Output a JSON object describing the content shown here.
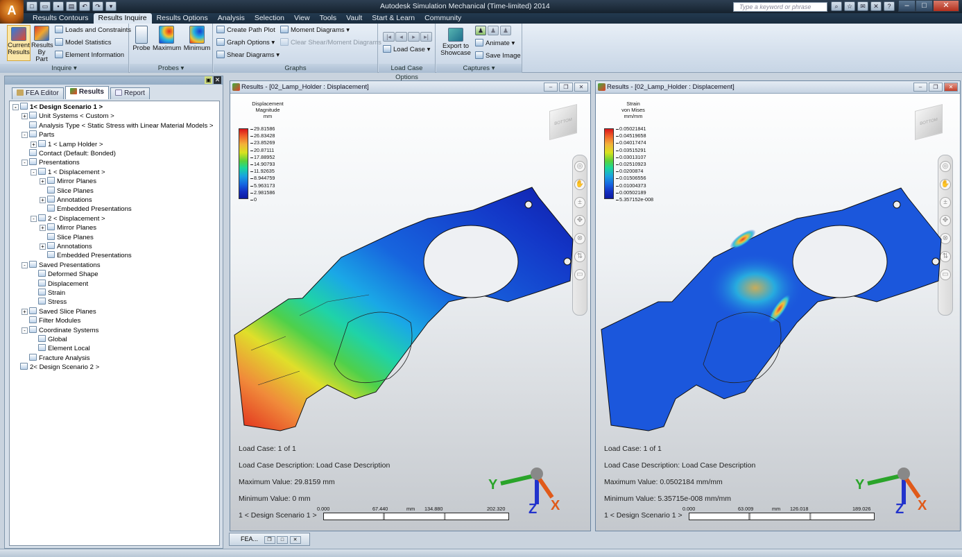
{
  "app": {
    "title": "Autodesk Simulation Mechanical (Time-limited) 2014",
    "search_placeholder": "Type a keyword or phrase"
  },
  "ribbon_tabs": [
    "Results Contours",
    "Results Inquire",
    "Results Options",
    "Analysis",
    "Selection",
    "View",
    "Tools",
    "Vault",
    "Start & Learn",
    "Community"
  ],
  "ribbon": {
    "inquire": {
      "title": "Inquire",
      "current_results": "Current Results",
      "results_by_part": "Results By Part",
      "loads_constraints": "Loads and Constraints",
      "model_statistics": "Model Statistics",
      "element_information": "Element Information"
    },
    "probes": {
      "title": "Probes",
      "probe": "Probe",
      "maximum": "Maximum",
      "minimum": "Minimum"
    },
    "graphs": {
      "title": "Graphs",
      "create_path_plot": "Create Path Plot",
      "graph_options": "Graph Options",
      "shear_diagrams": "Shear Diagrams",
      "moment_diagrams": "Moment Diagrams",
      "clear_shear_moment": "Clear Shear/Moment Diagrams"
    },
    "load_case_options": {
      "title": "Load Case Options",
      "load_case": "Load Case"
    },
    "captures": {
      "title": "Captures",
      "export_to_showcase": "Export to Showcase",
      "animate": "Animate",
      "save_image": "Save Image"
    }
  },
  "left_tabs": [
    "FEA Editor",
    "Results",
    "Report"
  ],
  "tree": [
    {
      "label": "1< Design Scenario 1 >",
      "depth": 0,
      "exp": "-",
      "bold": true
    },
    {
      "label": "Unit Systems < Custom >",
      "depth": 1,
      "exp": "+"
    },
    {
      "label": "Analysis Type < Static Stress with Linear Material Models >",
      "depth": 1,
      "exp": ""
    },
    {
      "label": "Parts",
      "depth": 1,
      "exp": "-"
    },
    {
      "label": "1 < Lamp Holder >",
      "depth": 2,
      "exp": "+"
    },
    {
      "label": "Contact (Default: Bonded)",
      "depth": 1,
      "exp": ""
    },
    {
      "label": "Presentations",
      "depth": 1,
      "exp": "-"
    },
    {
      "label": "1 < Displacement >",
      "depth": 2,
      "exp": "-"
    },
    {
      "label": "Mirror Planes",
      "depth": 3,
      "exp": "+"
    },
    {
      "label": "Slice Planes",
      "depth": 3,
      "exp": ""
    },
    {
      "label": "Annotations",
      "depth": 3,
      "exp": "+"
    },
    {
      "label": "Embedded Presentations",
      "depth": 3,
      "exp": ""
    },
    {
      "label": "2 < Displacement >",
      "depth": 2,
      "exp": "-"
    },
    {
      "label": "Mirror Planes",
      "depth": 3,
      "exp": "+"
    },
    {
      "label": "Slice Planes",
      "depth": 3,
      "exp": ""
    },
    {
      "label": "Annotations",
      "depth": 3,
      "exp": "+"
    },
    {
      "label": "Embedded Presentations",
      "depth": 3,
      "exp": ""
    },
    {
      "label": "Saved Presentations",
      "depth": 1,
      "exp": "-"
    },
    {
      "label": "Deformed Shape",
      "depth": 2,
      "exp": ""
    },
    {
      "label": "Displacement",
      "depth": 2,
      "exp": ""
    },
    {
      "label": "Strain",
      "depth": 2,
      "exp": ""
    },
    {
      "label": "Stress",
      "depth": 2,
      "exp": ""
    },
    {
      "label": "Saved Slice Planes",
      "depth": 1,
      "exp": "+"
    },
    {
      "label": "Filter Modules",
      "depth": 1,
      "exp": ""
    },
    {
      "label": "Coordinate Systems",
      "depth": 1,
      "exp": "-"
    },
    {
      "label": "Global",
      "depth": 2,
      "exp": ""
    },
    {
      "label": "Element Local",
      "depth": 2,
      "exp": ""
    },
    {
      "label": "Fracture Analysis",
      "depth": 1,
      "exp": ""
    },
    {
      "label": "2< Design Scenario 2 >",
      "depth": 0,
      "exp": ""
    }
  ],
  "windows": [
    {
      "title": "Results - [02_Lamp_Holder : Displacement]",
      "legend_title": [
        "Displacement",
        "Magnitude",
        "mm"
      ],
      "legend_values": [
        "29.81586",
        "26.83428",
        "23.85269",
        "20.87111",
        "17.88952",
        "14.90793",
        "11.92635",
        "8.944759",
        "5.963173",
        "2.981586",
        "0"
      ],
      "load_case": "Load Case:  1 of 1",
      "load_case_desc": "Load Case Description:  Load Case Description",
      "max_value": "Maximum Value: 29.8159 mm",
      "min_value": "Minimum Value: 0 mm",
      "scenario": "1 < Design Scenario 1 >",
      "scale_labels": [
        "0.000",
        "67.440",
        "mm",
        "134.880",
        "202.320"
      ]
    },
    {
      "title": "Results - [02_Lamp_Holder : Displacement]",
      "legend_title": [
        "Strain",
        "von Mises",
        "mm/mm"
      ],
      "legend_values": [
        "0.05021841",
        "0.04519658",
        "0.04017474",
        "0.03515291",
        "0.03013107",
        "0.02510923",
        "0.0200874",
        "0.01506556",
        "0.01004373",
        "0.00502189",
        "5.357152e-008"
      ],
      "load_case": "Load Case:  1 of 1",
      "load_case_desc": "Load Case Description:  Load Case Description",
      "max_value": "Maximum Value: 0.0502184 mm/mm",
      "min_value": "Minimum Value: 5.35715e-008 mm/mm",
      "scenario": "1 < Design Scenario 1 >",
      "scale_labels": [
        "0.000",
        "63.009",
        "mm",
        "126.018",
        "189.026"
      ]
    }
  ],
  "minimized_window": "FEA..."
}
